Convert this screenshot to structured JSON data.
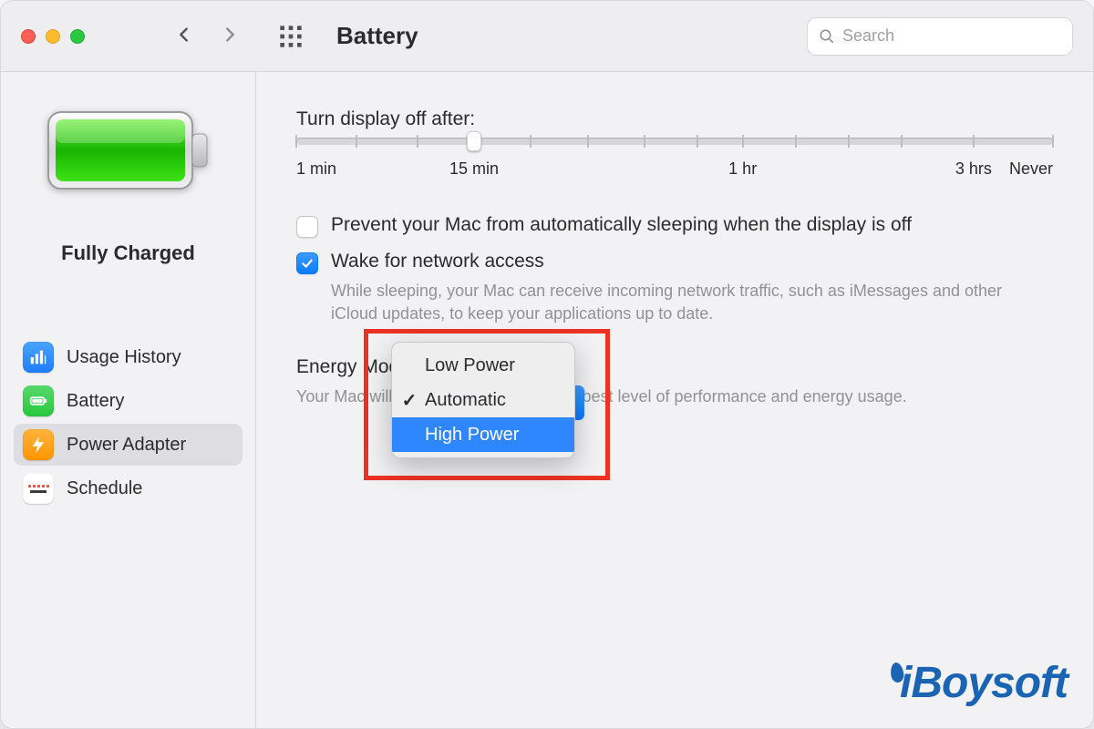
{
  "toolbar": {
    "title": "Battery",
    "search_placeholder": "Search"
  },
  "sidebar": {
    "battery_status": "Fully Charged",
    "items": [
      {
        "label": "Usage History"
      },
      {
        "label": "Battery"
      },
      {
        "label": "Power Adapter"
      },
      {
        "label": "Schedule"
      }
    ],
    "selected_index": 2
  },
  "main": {
    "display_off": {
      "label": "Turn display off after:",
      "tick_labels": [
        {
          "text": "1 min",
          "pos": 0
        },
        {
          "text": "15 min",
          "pos": 23.5
        },
        {
          "text": "1 hr",
          "pos": 59
        },
        {
          "text": "3 hrs",
          "pos": 89.5
        },
        {
          "text": "Never",
          "pos": 100
        }
      ],
      "tick_positions": [
        0,
        8,
        16,
        23.5,
        31,
        38.5,
        46,
        53,
        59,
        66,
        73,
        80,
        89.5,
        100
      ],
      "thumb_pos": 23.5
    },
    "prevent_sleep": {
      "label": "Prevent your Mac from automatically sleeping when the display is off",
      "checked": false
    },
    "wake_network": {
      "label": "Wake for network access",
      "checked": true,
      "desc": "While sleeping, your Mac can receive incoming network traffic, such as iMessages and other iCloud updates, to keep your applications up to date."
    },
    "energy_mode": {
      "label": "Energy Mode:",
      "desc": "Your Mac will automatically choose the best level of performance and energy usage.",
      "options": [
        {
          "label": "Low Power",
          "checked": false
        },
        {
          "label": "Automatic",
          "checked": true
        },
        {
          "label": "High Power",
          "checked": false
        }
      ],
      "highlighted_index": 2
    }
  },
  "watermark": "iBoysoft"
}
